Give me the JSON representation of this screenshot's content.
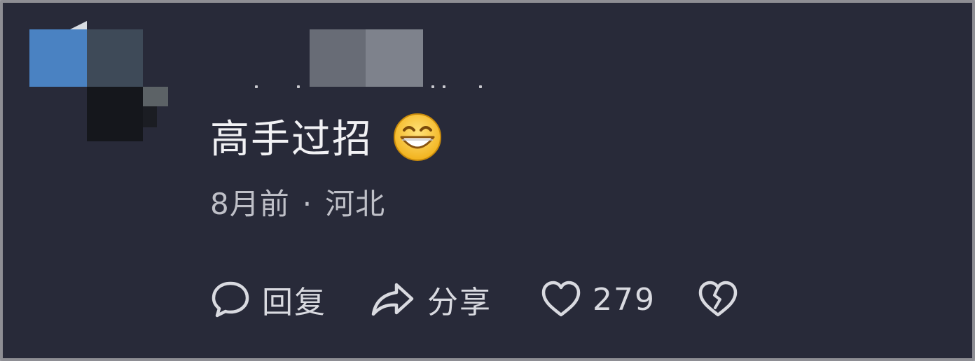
{
  "comment": {
    "text": "高手过招",
    "emoji": "grinning-face-emoji",
    "time": "8月前",
    "separator": "·",
    "location": "河北"
  },
  "actions": {
    "reply_label": "回复",
    "share_label": "分享",
    "like_count": "279"
  },
  "icons": {
    "reply": "speech-bubble-icon",
    "share": "share-arrow-icon",
    "like": "heart-outline-icon",
    "dislike": "broken-heart-icon"
  },
  "colors": {
    "background": "#282a39",
    "text_primary": "#f1f1f4",
    "text_secondary": "#bfc0c8"
  }
}
